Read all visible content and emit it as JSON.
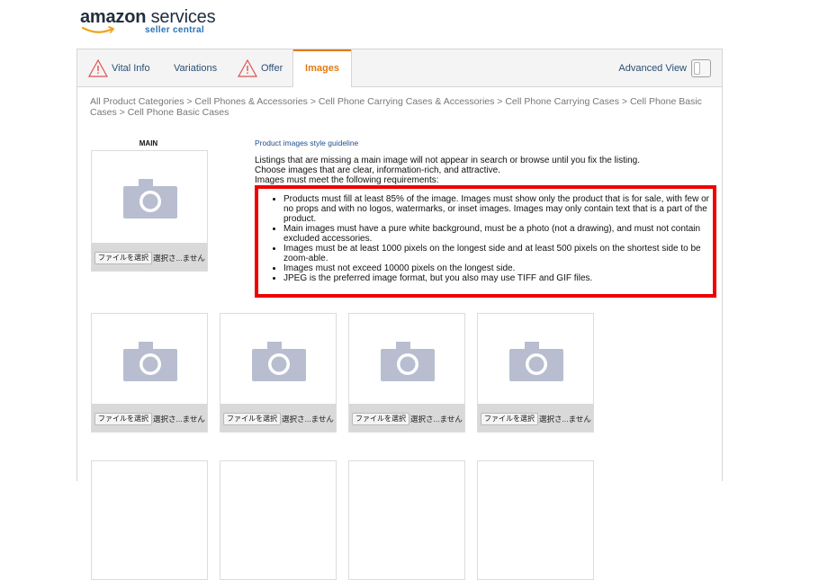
{
  "logo": {
    "brand_bold": "amazon",
    "brand_rest": " services",
    "sub": "seller central"
  },
  "tabs": [
    {
      "label": "Vital Info",
      "warning": true
    },
    {
      "label": "Variations",
      "warning": false
    },
    {
      "label": "Offer",
      "warning": true
    },
    {
      "label": "Images",
      "warning": false,
      "active": true
    }
  ],
  "advanced_view": {
    "label": "Advanced View"
  },
  "breadcrumb": "All Product Categories > Cell Phones & Accessories > Cell Phone Carrying Cases & Accessories > Cell Phone Carrying Cases > Cell Phone Basic Cases > Cell Phone Basic Cases",
  "main_slot": {
    "label": "MAIN"
  },
  "file_button_label": "ファイルを選択",
  "file_name_label": "選択さ...ません",
  "guide": {
    "link": "Product images style guideline",
    "intro": [
      "Listings that are missing a main image will not appear in search or browse until you fix the listing.",
      "Choose images that are clear, information-rich, and attractive.",
      "Images must meet the following requirements:"
    ],
    "requirements": [
      "Products must fill at least 85% of the image. Images must show only the product that is for sale, with few or no props and with no logos, watermarks, or inset images. Images may only contain text that is a part of the product.",
      "Main images must have a pure white background, must be a photo (not a drawing), and must not contain excluded accessories.",
      "Images must be at least 1000 pixels on the longest side and at least 500 pixels on the shortest side to be zoom-able.",
      "Images must not exceed 10000 pixels on the longest side.",
      "JPEG is the preferred image format, but you also may use TIFF and GIF files."
    ]
  },
  "colors": {
    "accent": "#e47911",
    "link": "#2a4f74",
    "highlight_box": "#ee0000",
    "camera": "#b8bed0"
  }
}
